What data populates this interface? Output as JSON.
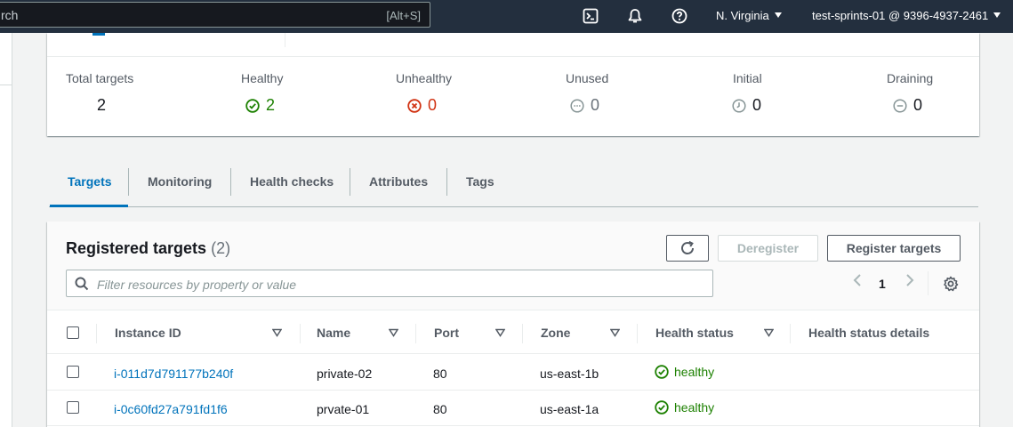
{
  "topbar": {
    "search_text": "rch",
    "search_shortcut": "[Alt+S]",
    "icons": [
      "cloudshell-icon",
      "notifications-icon",
      "help-icon"
    ],
    "region": "N. Virginia",
    "account": "test-sprints-01 @ 9396-4937-2461"
  },
  "summary": {
    "total": {
      "label": "Total targets",
      "value": "2"
    },
    "healthy": {
      "label": "Healthy",
      "value": "2",
      "color": "#1d8102",
      "icon": "check-circle-icon"
    },
    "unhealthy": {
      "label": "Unhealthy",
      "value": "0",
      "color": "#d13212",
      "icon": "x-circle-icon"
    },
    "unused": {
      "label": "Unused",
      "value": "0",
      "color": "#687078",
      "icon": "dots-circle-icon"
    },
    "initial": {
      "label": "Initial",
      "value": "0",
      "color": "#16191f",
      "icon": "clock-icon"
    },
    "draining": {
      "label": "Draining",
      "value": "0",
      "color": "#16191f",
      "icon": "minus-circle-icon"
    }
  },
  "tabs": [
    {
      "label": "Targets",
      "active": true
    },
    {
      "label": "Monitoring",
      "active": false
    },
    {
      "label": "Health checks",
      "active": false
    },
    {
      "label": "Attributes",
      "active": false
    },
    {
      "label": "Tags",
      "active": false
    }
  ],
  "registered": {
    "title": "Registered targets",
    "count": "(2)",
    "refresh_icon": "refresh-icon",
    "deregister_label": "Deregister",
    "register_label": "Register targets",
    "filter_placeholder": "Filter resources by property or value",
    "page_number": "1",
    "columns": [
      "Instance ID",
      "Name",
      "Port",
      "Zone",
      "Health status",
      "Health status details"
    ],
    "rows": [
      {
        "instance_id": "i-011d7d791177b240f",
        "name": "private-02",
        "port": "80",
        "zone": "us-east-1b",
        "health": "healthy",
        "details": ""
      },
      {
        "instance_id": "i-0c60fd27a791fd1f6",
        "name": "prvate-01",
        "port": "80",
        "zone": "us-east-1a",
        "health": "healthy",
        "details": ""
      }
    ]
  },
  "colors": {
    "topbar": "#232f3e",
    "accent": "#0073bb",
    "healthy": "#1d8102",
    "unhealthy": "#d13212"
  }
}
